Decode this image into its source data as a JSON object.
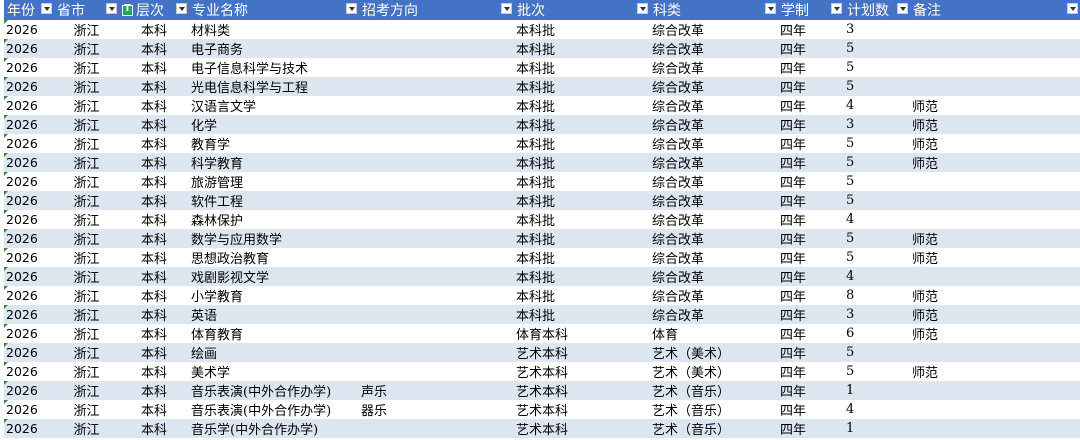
{
  "headers": {
    "year": "年份",
    "province": "省市",
    "level": "层次",
    "major": "专业名称",
    "direction": "招考方向",
    "batch": "批次",
    "category": "科类",
    "duration": "学制",
    "plan": "计划数",
    "note": "备注"
  },
  "rows": [
    {
      "year": "2026",
      "province": "浙江",
      "level": "本科",
      "major": "材料类",
      "direction": "",
      "batch": "本科批",
      "category": "综合改革",
      "duration": "四年",
      "plan": "3",
      "note": ""
    },
    {
      "year": "2026",
      "province": "浙江",
      "level": "本科",
      "major": "电子商务",
      "direction": "",
      "batch": "本科批",
      "category": "综合改革",
      "duration": "四年",
      "plan": "5",
      "note": ""
    },
    {
      "year": "2026",
      "province": "浙江",
      "level": "本科",
      "major": "电子信息科学与技术",
      "direction": "",
      "batch": "本科批",
      "category": "综合改革",
      "duration": "四年",
      "plan": "5",
      "note": ""
    },
    {
      "year": "2026",
      "province": "浙江",
      "level": "本科",
      "major": "光电信息科学与工程",
      "direction": "",
      "batch": "本科批",
      "category": "综合改革",
      "duration": "四年",
      "plan": "5",
      "note": ""
    },
    {
      "year": "2026",
      "province": "浙江",
      "level": "本科",
      "major": "汉语言文学",
      "direction": "",
      "batch": "本科批",
      "category": "综合改革",
      "duration": "四年",
      "plan": "4",
      "note": "师范"
    },
    {
      "year": "2026",
      "province": "浙江",
      "level": "本科",
      "major": "化学",
      "direction": "",
      "batch": "本科批",
      "category": "综合改革",
      "duration": "四年",
      "plan": "3",
      "note": "师范"
    },
    {
      "year": "2026",
      "province": "浙江",
      "level": "本科",
      "major": "教育学",
      "direction": "",
      "batch": "本科批",
      "category": "综合改革",
      "duration": "四年",
      "plan": "5",
      "note": "师范"
    },
    {
      "year": "2026",
      "province": "浙江",
      "level": "本科",
      "major": "科学教育",
      "direction": "",
      "batch": "本科批",
      "category": "综合改革",
      "duration": "四年",
      "plan": "5",
      "note": "师范"
    },
    {
      "year": "2026",
      "province": "浙江",
      "level": "本科",
      "major": "旅游管理",
      "direction": "",
      "batch": "本科批",
      "category": "综合改革",
      "duration": "四年",
      "plan": "5",
      "note": ""
    },
    {
      "year": "2026",
      "province": "浙江",
      "level": "本科",
      "major": "软件工程",
      "direction": "",
      "batch": "本科批",
      "category": "综合改革",
      "duration": "四年",
      "plan": "5",
      "note": ""
    },
    {
      "year": "2026",
      "province": "浙江",
      "level": "本科",
      "major": "森林保护",
      "direction": "",
      "batch": "本科批",
      "category": "综合改革",
      "duration": "四年",
      "plan": "4",
      "note": ""
    },
    {
      "year": "2026",
      "province": "浙江",
      "level": "本科",
      "major": "数学与应用数学",
      "direction": "",
      "batch": "本科批",
      "category": "综合改革",
      "duration": "四年",
      "plan": "5",
      "note": "师范"
    },
    {
      "year": "2026",
      "province": "浙江",
      "level": "本科",
      "major": "思想政治教育",
      "direction": "",
      "batch": "本科批",
      "category": "综合改革",
      "duration": "四年",
      "plan": "5",
      "note": "师范"
    },
    {
      "year": "2026",
      "province": "浙江",
      "level": "本科",
      "major": "戏剧影视文学",
      "direction": "",
      "batch": "本科批",
      "category": "综合改革",
      "duration": "四年",
      "plan": "4",
      "note": ""
    },
    {
      "year": "2026",
      "province": "浙江",
      "level": "本科",
      "major": "小学教育",
      "direction": "",
      "batch": "本科批",
      "category": "综合改革",
      "duration": "四年",
      "plan": "8",
      "note": "师范"
    },
    {
      "year": "2026",
      "province": "浙江",
      "level": "本科",
      "major": "英语",
      "direction": "",
      "batch": "本科批",
      "category": "综合改革",
      "duration": "四年",
      "plan": "3",
      "note": "师范"
    },
    {
      "year": "2026",
      "province": "浙江",
      "level": "本科",
      "major": "体育教育",
      "direction": "",
      "batch": "体育本科",
      "category": "体育",
      "duration": "四年",
      "plan": "6",
      "note": "师范"
    },
    {
      "year": "2026",
      "province": "浙江",
      "level": "本科",
      "major": "绘画",
      "direction": "",
      "batch": "艺术本科",
      "category": "艺术（美术）",
      "duration": "四年",
      "plan": "5",
      "note": ""
    },
    {
      "year": "2026",
      "province": "浙江",
      "level": "本科",
      "major": "美术学",
      "direction": "",
      "batch": "艺术本科",
      "category": "艺术（美术）",
      "duration": "四年",
      "plan": "5",
      "note": "师范"
    },
    {
      "year": "2026",
      "province": "浙江",
      "level": "本科",
      "major": "音乐表演(中外合作办学)",
      "direction": "声乐",
      "batch": "艺术本科",
      "category": "艺术（音乐）",
      "duration": "四年",
      "plan": "1",
      "note": ""
    },
    {
      "year": "2026",
      "province": "浙江",
      "level": "本科",
      "major": "音乐表演(中外合作办学)",
      "direction": "器乐",
      "batch": "艺术本科",
      "category": "艺术（音乐）",
      "duration": "四年",
      "plan": "4",
      "note": ""
    },
    {
      "year": "2026",
      "province": "浙江",
      "level": "本科",
      "major": "音乐学(中外合作办学)",
      "direction": "",
      "batch": "艺术本科",
      "category": "艺术（音乐）",
      "duration": "四年",
      "plan": "1",
      "note": ""
    }
  ]
}
